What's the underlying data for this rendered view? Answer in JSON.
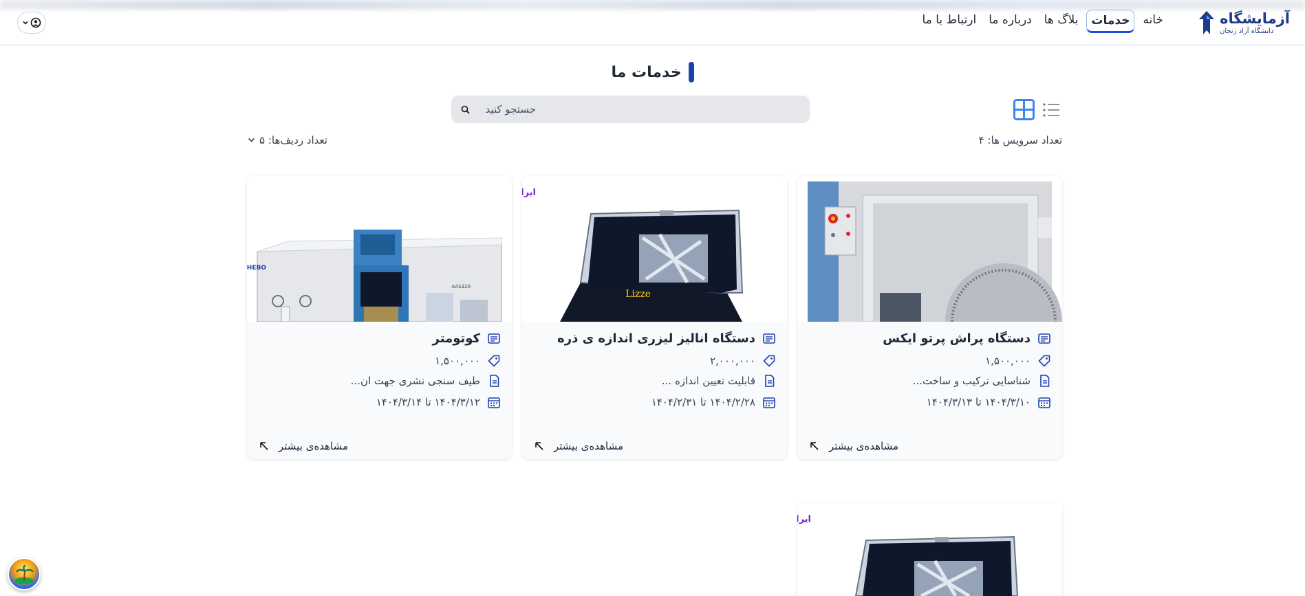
{
  "header": {
    "brand_title": "آزمایشگاه",
    "brand_subtitle": "دانشگاه آزاد زنجان",
    "nav": [
      {
        "label": "خانه"
      },
      {
        "label": "خدمات",
        "active": true
      },
      {
        "label": "بلاگ ها"
      },
      {
        "label": "درباره ما"
      },
      {
        "label": "ارتباط با ما"
      }
    ],
    "user_icon": "user-circle-icon"
  },
  "page": {
    "title": "خدمات ما",
    "search_placeholder": "جستجو کنید",
    "services_count_label": "تعداد سرویس ها: ۴",
    "rows_count_label": "تعداد ردیف‌ها: ۵"
  },
  "cards": [
    {
      "title": "دستگاه پراش پرتو ایکس",
      "price": "۱,۵۰۰,۰۰۰",
      "description": "شناسایی ترکیب و ساخت...",
      "date": "۱۴۰۴/۳/۱۰ تا ۱۴۰۴/۳/۱۳",
      "more": "مشاهده‌ی بیشتر"
    },
    {
      "title": "دستگاه انالیز لیزری اندازه ی ذره",
      "price": "۲,۰۰۰,۰۰۰",
      "description": "قابلیت تعیین اندازه ...",
      "date": "۱۴۰۴/۲/۲۸ تا ۱۴۰۴/۲/۳۱",
      "more": "مشاهده‌ی بیشتر",
      "watermark": "ایران‌ابزار"
    },
    {
      "title": "کوتومتر",
      "price": "۱,۵۰۰,۰۰۰",
      "description": "طیف سنجی نشری جهت ان...",
      "date": "۱۴۰۴/۳/۱۲ تا ۱۴۰۴/۳/۱۴",
      "more": "مشاهده‌ی بیشتر"
    },
    {
      "watermark": "ایران‌ابزار"
    }
  ],
  "colors": {
    "accent": "#1e40af",
    "active_nav_border": "#1d4ed8",
    "grid_view_active": "#3b82f6",
    "card_bg": "#f8fafc",
    "search_bg": "#e5e7eb"
  }
}
